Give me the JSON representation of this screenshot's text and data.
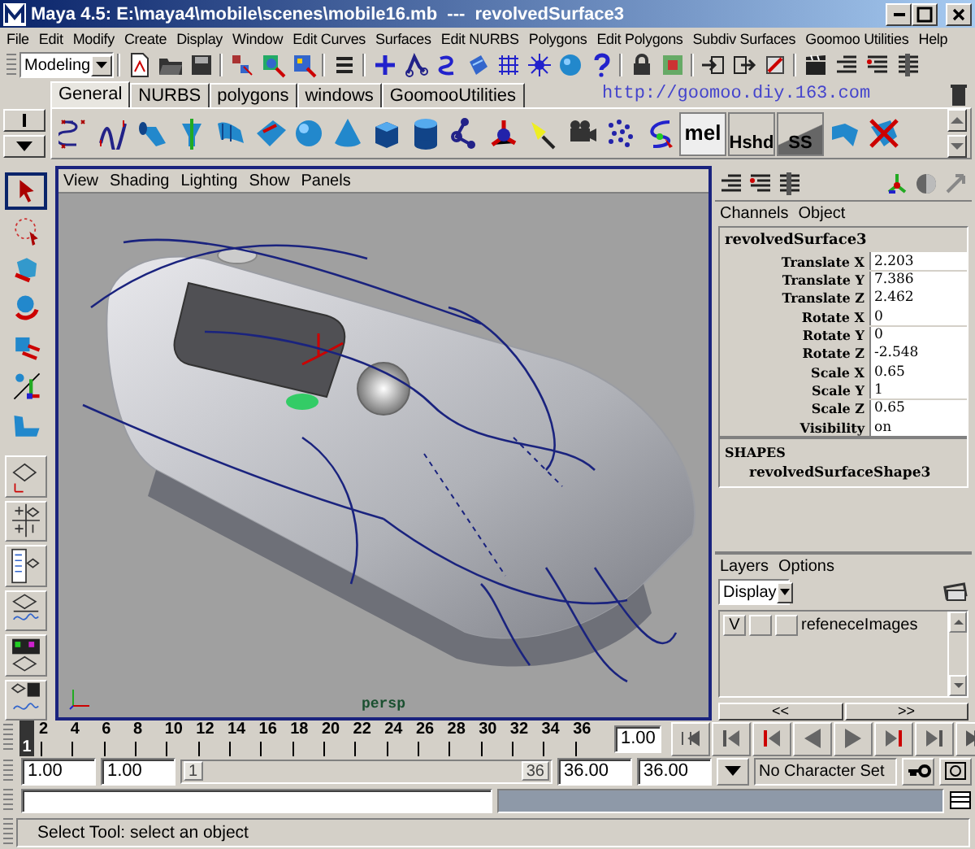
{
  "window": {
    "title": "Maya 4.5: E:\\maya4\\mobile\\scenes\\mobile16.mb  ---  revolvedSurface3"
  },
  "menu": [
    "File",
    "Edit",
    "Modify",
    "Create",
    "Display",
    "Window",
    "Edit Curves",
    "Surfaces",
    "Edit NURBS",
    "Polygons",
    "Edit Polygons",
    "Subdiv Surfaces",
    "Goomoo Utilities",
    "Help"
  ],
  "status_line": {
    "mode": "Modeling"
  },
  "shelf": {
    "tabs": [
      {
        "label": "General",
        "selected": true
      },
      {
        "label": "NURBS",
        "selected": false
      },
      {
        "label": "polygons",
        "selected": false
      },
      {
        "label": "windows",
        "selected": false
      },
      {
        "label": "GoomooUtilities",
        "selected": false
      }
    ],
    "url": "http://goomoo.diy.163.com",
    "text_buttons": [
      "mel",
      "Hshd",
      "SS"
    ]
  },
  "toolbox": {
    "tools": [
      {
        "selected": true
      },
      {
        "selected": false
      },
      {
        "selected": false
      },
      {
        "selected": false
      },
      {
        "selected": false
      },
      {
        "selected": false
      },
      {
        "selected": false
      }
    ]
  },
  "viewport": {
    "menu": [
      "View",
      "Shading",
      "Lighting",
      "Show",
      "Panels"
    ],
    "camera": "persp"
  },
  "channel_box": {
    "menu": [
      "Channels",
      "Object"
    ],
    "object": "revolvedSurface3",
    "channels": [
      {
        "name": "Translate X",
        "value": "2.203"
      },
      {
        "name": "Translate Y",
        "value": "7.386"
      },
      {
        "name": "Translate Z",
        "value": "2.462"
      },
      {
        "name": "Rotate X",
        "value": "0"
      },
      {
        "name": "Rotate Y",
        "value": "0"
      },
      {
        "name": "Rotate Z",
        "value": "-2.548"
      },
      {
        "name": "Scale X",
        "value": "0.65"
      },
      {
        "name": "Scale Y",
        "value": "1"
      },
      {
        "name": "Scale Z",
        "value": "0.65"
      },
      {
        "name": "Visibility",
        "value": "on"
      }
    ],
    "shapes_heading": "SHAPES",
    "shape": "revolvedSurfaceShape3"
  },
  "layers": {
    "menu": [
      "Layers",
      "Options"
    ],
    "display": "Display",
    "items": [
      {
        "visible": "V",
        "name": "refeneceImages"
      }
    ],
    "nav": [
      "<<",
      ">>"
    ]
  },
  "time_slider": {
    "current_frame": "1",
    "ticks": [
      "2",
      "4",
      "6",
      "8",
      "10",
      "12",
      "14",
      "16",
      "18",
      "20",
      "22",
      "24",
      "26",
      "28",
      "30",
      "32",
      "34",
      "36"
    ],
    "current_time": "1.00"
  },
  "range_slider": {
    "level": 1,
    "start": "1.00",
    "playback_start": "1.00",
    "handle_start": "1",
    "handle_end": "36",
    "playback_end": "36.00",
    "end": "36.00",
    "character_set": "No Character Set"
  },
  "help_line": "Select Tool: select an object"
}
